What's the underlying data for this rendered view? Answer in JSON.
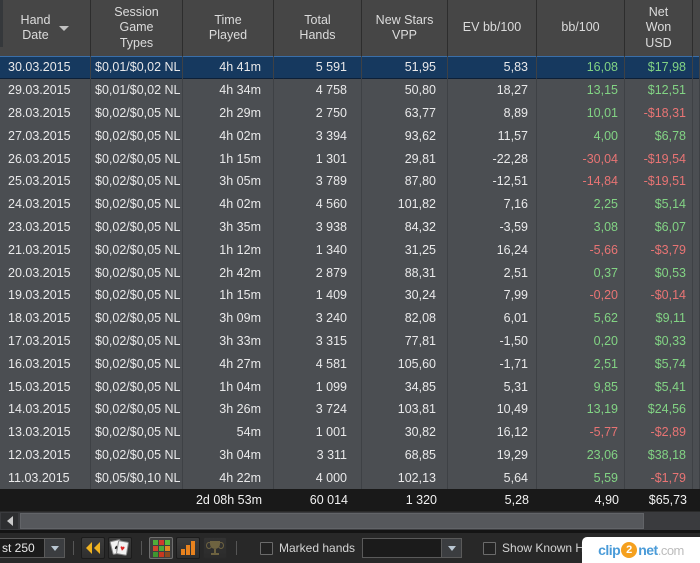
{
  "table": {
    "headers": [
      "Hand\nDate",
      "Session\nGame\nTypes",
      "Time\nPlayed",
      "Total\nHands",
      "New Stars\nVPP",
      "EV bb/100",
      "bb/100",
      "Net\nWon\nUSD"
    ],
    "rows": [
      {
        "date": "30.03.2015",
        "game": "$0,01/$0,02 NL",
        "time": "4h 41m",
        "hands": "5 591",
        "vpp": "51,95",
        "ev": "5,83",
        "bb100": "16,08",
        "net": "$17,98",
        "selected": true
      },
      {
        "date": "29.03.2015",
        "game": "$0,01/$0,02 NL",
        "time": "4h 34m",
        "hands": "4 758",
        "vpp": "50,80",
        "ev": "18,27",
        "bb100": "13,15",
        "net": "$12,51",
        "selected": false
      },
      {
        "date": "28.03.2015",
        "game": "$0,02/$0,05 NL",
        "time": "2h 29m",
        "hands": "2 750",
        "vpp": "63,77",
        "ev": "8,89",
        "bb100": "10,01",
        "net": "-$18,31",
        "selected": false
      },
      {
        "date": "27.03.2015",
        "game": "$0,02/$0,05 NL",
        "time": "4h 02m",
        "hands": "3 394",
        "vpp": "93,62",
        "ev": "11,57",
        "bb100": "4,00",
        "net": "$6,78",
        "selected": false
      },
      {
        "date": "26.03.2015",
        "game": "$0,02/$0,05 NL",
        "time": "1h 15m",
        "hands": "1 301",
        "vpp": "29,81",
        "ev": "-22,28",
        "bb100": "-30,04",
        "net": "-$19,54",
        "selected": false
      },
      {
        "date": "25.03.2015",
        "game": "$0,02/$0,05 NL",
        "time": "3h 05m",
        "hands": "3 789",
        "vpp": "87,80",
        "ev": "-12,51",
        "bb100": "-14,84",
        "net": "-$19,51",
        "selected": false
      },
      {
        "date": "24.03.2015",
        "game": "$0,02/$0,05 NL",
        "time": "4h 02m",
        "hands": "4 560",
        "vpp": "101,82",
        "ev": "7,16",
        "bb100": "2,25",
        "net": "$5,14",
        "selected": false
      },
      {
        "date": "23.03.2015",
        "game": "$0,02/$0,05 NL",
        "time": "3h 35m",
        "hands": "3 938",
        "vpp": "84,32",
        "ev": "-3,59",
        "bb100": "3,08",
        "net": "$6,07",
        "selected": false
      },
      {
        "date": "21.03.2015",
        "game": "$0,02/$0,05 NL",
        "time": "1h 12m",
        "hands": "1 340",
        "vpp": "31,25",
        "ev": "16,24",
        "bb100": "-5,66",
        "net": "-$3,79",
        "selected": false
      },
      {
        "date": "20.03.2015",
        "game": "$0,02/$0,05 NL",
        "time": "2h 42m",
        "hands": "2 879",
        "vpp": "88,31",
        "ev": "2,51",
        "bb100": "0,37",
        "net": "$0,53",
        "selected": false
      },
      {
        "date": "19.03.2015",
        "game": "$0,02/$0,05 NL",
        "time": "1h 15m",
        "hands": "1 409",
        "vpp": "30,24",
        "ev": "7,99",
        "bb100": "-0,20",
        "net": "-$0,14",
        "selected": false
      },
      {
        "date": "18.03.2015",
        "game": "$0,02/$0,05 NL",
        "time": "3h 09m",
        "hands": "3 240",
        "vpp": "82,08",
        "ev": "6,01",
        "bb100": "5,62",
        "net": "$9,11",
        "selected": false
      },
      {
        "date": "17.03.2015",
        "game": "$0,02/$0,05 NL",
        "time": "3h 33m",
        "hands": "3 315",
        "vpp": "77,81",
        "ev": "-1,50",
        "bb100": "0,20",
        "net": "$0,33",
        "selected": false
      },
      {
        "date": "16.03.2015",
        "game": "$0,02/$0,05 NL",
        "time": "4h 27m",
        "hands": "4 581",
        "vpp": "105,60",
        "ev": "-1,71",
        "bb100": "2,51",
        "net": "$5,74",
        "selected": false
      },
      {
        "date": "15.03.2015",
        "game": "$0,02/$0,05 NL",
        "time": "1h 04m",
        "hands": "1 099",
        "vpp": "34,85",
        "ev": "5,31",
        "bb100": "9,85",
        "net": "$5,41",
        "selected": false
      },
      {
        "date": "14.03.2015",
        "game": "$0,02/$0,05 NL",
        "time": "3h 26m",
        "hands": "3 724",
        "vpp": "103,81",
        "ev": "10,49",
        "bb100": "13,19",
        "net": "$24,56",
        "selected": false
      },
      {
        "date": "13.03.2015",
        "game": "$0,02/$0,05 NL",
        "time": "54m",
        "hands": "1 001",
        "vpp": "30,82",
        "ev": "16,12",
        "bb100": "-5,77",
        "net": "-$2,89",
        "selected": false
      },
      {
        "date": "12.03.2015",
        "game": "$0,02/$0,05 NL",
        "time": "3h 04m",
        "hands": "3 311",
        "vpp": "68,85",
        "ev": "19,29",
        "bb100": "23,06",
        "net": "$38,18",
        "selected": false
      },
      {
        "date": "11.03.2015",
        "game": "$0,05/$0,10 NL",
        "time": "4h 22m",
        "hands": "4 000",
        "vpp": "102,13",
        "ev": "5,64",
        "bb100": "5,59",
        "net": "-$1,79",
        "selected": false
      }
    ],
    "totals": {
      "date": "",
      "game": "",
      "time": "2d 08h 53m",
      "hands": "60 014",
      "vpp": "1 320",
      "ev": "5,28",
      "bb100": "4,90",
      "net": "$65,73"
    }
  },
  "toolbar": {
    "range_dropdown_value": "st 250",
    "marked_hands_label": "Marked hands",
    "marked_hands_dropdown_value": "",
    "show_known_label": "Show Known Holecards",
    "grid_icon_colors": [
      "#4fae3a",
      "#cf3a2e",
      "#58bb39",
      "#d0452c",
      "#4cab36",
      "#e08a22",
      "#3f9630",
      "#c8391f",
      "#8a4a20"
    ]
  },
  "watermark": {
    "part1": "clip",
    "part2": "2",
    "part3": "net",
    "part4": ".com"
  },
  "colors": {
    "positive": "#82d384",
    "negative": "#e87474",
    "selection_bg": "#16395f",
    "selection_border": "#3a6ea8",
    "header_bg": "#464646",
    "row_bg": "#4b4e52",
    "totals_bg": "#191919",
    "toolbar_bg": "#282828",
    "accent_orange": "#f5a01e",
    "accent_blue": "#4a9bd8"
  }
}
